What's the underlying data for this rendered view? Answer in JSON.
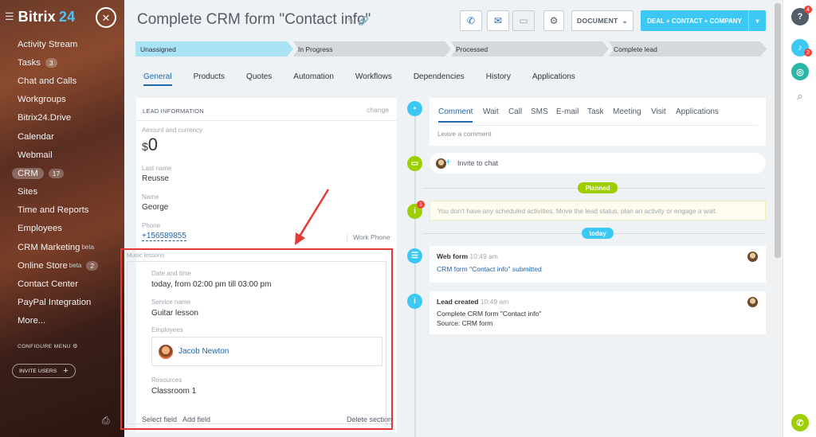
{
  "sidebar": {
    "logo_prefix": "Bitrix",
    "logo_suffix": "24",
    "items": [
      {
        "label": "Activity Stream",
        "count": "",
        "beta": ""
      },
      {
        "label": "Tasks",
        "count": "3",
        "beta": ""
      },
      {
        "label": "Chat and Calls",
        "count": "",
        "beta": ""
      },
      {
        "label": "Workgroups",
        "count": "",
        "beta": ""
      },
      {
        "label": "Bitrix24.Drive",
        "count": "",
        "beta": ""
      },
      {
        "label": "Calendar",
        "count": "",
        "beta": ""
      },
      {
        "label": "Webmail",
        "count": "",
        "beta": ""
      },
      {
        "label": "CRM",
        "count": "17",
        "beta": ""
      },
      {
        "label": "Sites",
        "count": "",
        "beta": ""
      },
      {
        "label": "Time and Reports",
        "count": "",
        "beta": ""
      },
      {
        "label": "Employees",
        "count": "",
        "beta": ""
      },
      {
        "label": "CRM Marketing",
        "count": "",
        "beta": "beta"
      },
      {
        "label": "Online Store",
        "count": "2",
        "beta": "beta"
      },
      {
        "label": "Contact Center",
        "count": "",
        "beta": ""
      },
      {
        "label": "PayPal Integration",
        "count": "",
        "beta": ""
      },
      {
        "label": "More...",
        "count": "",
        "beta": ""
      }
    ],
    "configure_menu": "CONFIGURE MENU",
    "invite_users": "INVITE USERS"
  },
  "header": {
    "title": "Complete CRM form \"Contact info\"",
    "document_label": "DOCUMENT",
    "deal_label": "DEAL + CONTACT + COMPANY"
  },
  "stages": [
    "Unassigned",
    "In Progress",
    "Processed",
    "Complete lead"
  ],
  "tabs": [
    "General",
    "Products",
    "Quotes",
    "Automation",
    "Workflows",
    "Dependencies",
    "History",
    "Applications"
  ],
  "lead": {
    "section_title": "LEAD INFORMATION",
    "change": "change",
    "amount_label": "Amount and currency",
    "currency": "$",
    "amount": "0",
    "last_name_label": "Last name",
    "last_name": "Reusse",
    "name_label": "Name",
    "name": "George",
    "phone_label": "Phone",
    "phone": "+156589855",
    "phone_type": "Work Phone"
  },
  "music": {
    "title": "Music lessons",
    "date_label": "Date and time",
    "date_value": "today, from 02:00 pm till 03:00 pm",
    "service_label": "Service name",
    "service_value": "Guitar lesson",
    "employees_label": "Employees",
    "employee_name": "Jacob Newton",
    "resources_label": "Resources",
    "resources_value": "Classroom 1"
  },
  "footer": {
    "select_field": "Select field",
    "add_field": "Add field",
    "delete_section": "Delete section"
  },
  "activity": {
    "tabs": [
      "Comment",
      "Wait",
      "Call",
      "SMS",
      "E-mail",
      "Task",
      "Meeting",
      "Visit",
      "Applications"
    ],
    "placeholder": "Leave a comment",
    "invite_chat": "Invite to chat",
    "planned": "Planned",
    "info_count": "1",
    "no_activities": "You don't have any scheduled activities. Move the lead status, plan an activity or engage a wait.",
    "today": "today",
    "webform_title": "Web form",
    "webform_time": "10:49 am",
    "webform_link": "CRM form \"Contact info\" submitted",
    "created_title": "Lead created",
    "created_time": "10:49 am",
    "created_line1": "Complete CRM form \"Contact info\"",
    "created_line2": "Source: CRM form"
  },
  "right": {
    "help_badge": "4",
    "bell_badge": "2"
  },
  "colors": {
    "accent": "#3bc8f5",
    "link": "#2067b0",
    "green": "#9dcf00",
    "annotation": "#e53935"
  }
}
